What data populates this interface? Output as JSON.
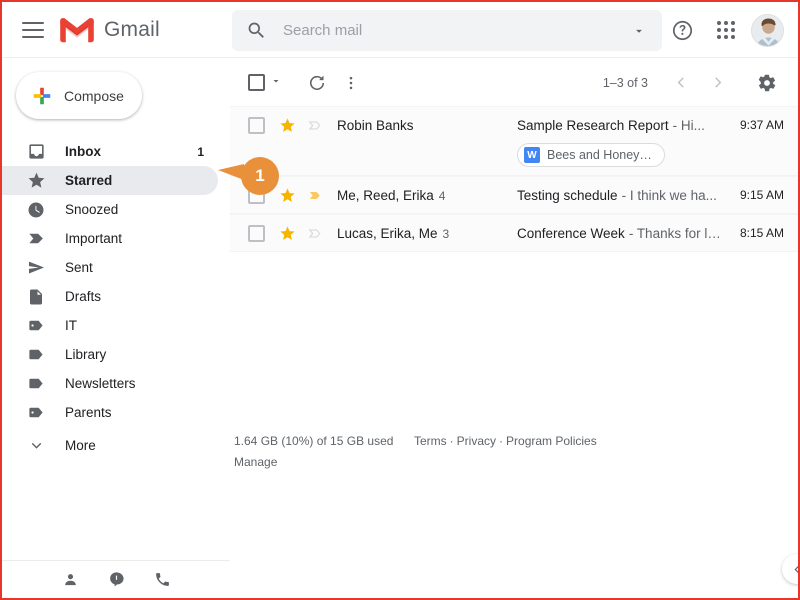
{
  "app": {
    "brand": "Gmail"
  },
  "topbar": {
    "menu_icon": "hamburger-menu-icon",
    "logo_icon": "gmail-m-logo-icon",
    "help_icon": "help-question-icon",
    "apps_icon": "google-apps-grid-icon",
    "avatar_icon": "user-avatar"
  },
  "search": {
    "placeholder": "Search mail",
    "value": "",
    "icon": "search-icon",
    "options_icon": "chevron-down-icon"
  },
  "sidebar": {
    "compose": {
      "label": "Compose",
      "icon": "plus-icon"
    },
    "items": [
      {
        "label": "Inbox",
        "icon": "inbox-icon",
        "count": "1",
        "active": false,
        "bold": true
      },
      {
        "label": "Starred",
        "icon": "star-icon",
        "count": "",
        "active": true,
        "bold": false
      },
      {
        "label": "Snoozed",
        "icon": "clock-icon",
        "count": "",
        "active": false,
        "bold": false
      },
      {
        "label": "Important",
        "icon": "important-icon",
        "count": "",
        "active": false,
        "bold": false
      },
      {
        "label": "Sent",
        "icon": "send-icon",
        "count": "",
        "active": false,
        "bold": false
      },
      {
        "label": "Drafts",
        "icon": "draft-file-icon",
        "count": "",
        "active": false,
        "bold": false
      },
      {
        "label": "IT",
        "icon": "label-tag-icon",
        "count": "",
        "active": false,
        "bold": false
      },
      {
        "label": "Library",
        "icon": "label-tag-icon",
        "count": "",
        "active": false,
        "bold": false
      },
      {
        "label": "Newsletters",
        "icon": "label-tag-icon",
        "count": "",
        "active": false,
        "bold": false
      },
      {
        "label": "Parents",
        "icon": "label-tag-icon",
        "count": "",
        "active": false,
        "bold": false
      },
      {
        "label": "More",
        "icon": "chevron-down-icon",
        "count": "",
        "active": false,
        "bold": false
      }
    ],
    "bottom_icons": [
      "contacts-person-icon",
      "hangouts-chat-icon",
      "phone-call-icon"
    ]
  },
  "toolbar": {
    "select_all_icon": "checkbox-icon",
    "select_caret_icon": "chevron-down-icon",
    "refresh_icon": "refresh-icon",
    "more_icon": "more-vertical-icon",
    "page_range": "1–3 of 3",
    "prev_icon": "chevron-left-icon",
    "next_icon": "chevron-right-icon",
    "settings_icon": "gear-icon"
  },
  "mail_list": [
    {
      "senders": "Robin Banks",
      "count": "",
      "subject": "Sample Research Report",
      "snippet": "- Hi...",
      "time": "9:37 AM",
      "starred": true,
      "important": false,
      "attachment": {
        "label": "Bees and Honey…",
        "doc_badge": "W"
      }
    },
    {
      "senders": "Me, Reed, Erika",
      "count": "4",
      "subject": "Testing schedule",
      "snippet": "- I think we ha...",
      "time": "9:15 AM",
      "starred": true,
      "important": true,
      "attachment": null
    },
    {
      "senders": "Lucas, Erika, Me",
      "count": "3",
      "subject": "Conference Week",
      "snippet": "- Thanks for le...",
      "time": "8:15 AM",
      "starred": true,
      "important": false,
      "attachment": null
    }
  ],
  "footer": {
    "storage": "1.64 GB (10%) of 15 GB used",
    "manage": "Manage",
    "terms": "Terms",
    "privacy": "Privacy",
    "policies": "Program Policies",
    "sep": "·"
  },
  "annotations": [
    {
      "number": "1",
      "color": "#e8913a",
      "target": "sidebar-item-starred"
    }
  ],
  "side_collapse": {
    "icon": "chevron-left-icon"
  },
  "colors": {
    "gmail_red": "#ea4335",
    "accent_blue": "#4285f4",
    "star_yellow": "#f4b400",
    "active_gray": "#e8eaed",
    "frame_red": "#e8372a"
  }
}
